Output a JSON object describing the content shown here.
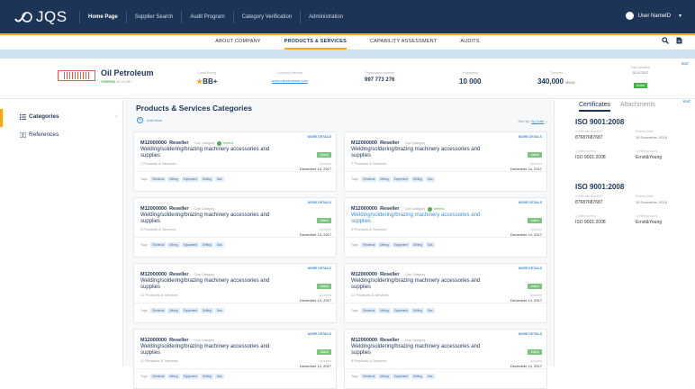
{
  "app": {
    "logo": "JQS"
  },
  "nav": {
    "items": [
      "Home Page",
      "Supplier Search",
      "Audit Program",
      "Category Verification",
      "Administration"
    ],
    "active": 0
  },
  "user": {
    "name": "User NameID"
  },
  "subnav": {
    "items": [
      "ABOUT COMPANY",
      "PRODUCTS & SERVICES",
      "CAPABILITY ASSESSMENT",
      "AUDITS"
    ],
    "active": 1
  },
  "company": {
    "logo_text": "OIL PETROLEUM",
    "name": "Oil Petroleum",
    "status_label": "VERIFIED",
    "status_date": "12.10.2017",
    "credit_rating_label": "Credit Rating",
    "credit_rating": "BB+",
    "website_label": "Company Website",
    "website": "www.oilpetroleum.com",
    "org_number_label": "Organisation number",
    "org_number": "997 773 276",
    "employees_label": "Employees",
    "employees": "10 000",
    "turnover_label": "Turnover",
    "turnover": "340,000",
    "turnover_unit": "MNOK",
    "last_updated_label": "Last Updated",
    "last_updated": "02.12.2017",
    "last_updated_badge": "Active",
    "edit": "EDIT"
  },
  "sidebar": {
    "items": [
      "Categories",
      "References"
    ],
    "active": 0
  },
  "main": {
    "title": "Products & Services Categories",
    "add_more": "Add More",
    "sort_by_label": "Sort by:",
    "sort_by_value": "By Date",
    "cards": [
      {
        "code": "M12000000",
        "type": "Reseller",
        "cat": "Core Category",
        "verified": true,
        "title": "Welding/soldering/brazing machinery accessories and supplies",
        "title_blue": false,
        "count": "7 Products & Services",
        "status": "Active",
        "updated": "Updated",
        "date": "December 14, 2017"
      },
      {
        "code": "M12000000",
        "type": "Reseller",
        "cat": "Core Category",
        "verified": false,
        "title": "Welding/soldering/brazing machinery accessories and supplies",
        "title_blue": false,
        "count": "7 Products & Services",
        "status": "Active",
        "updated": "Updated",
        "date": "December 14, 2017"
      },
      {
        "code": "M12000000",
        "type": "Reseller",
        "cat": "Core Category",
        "verified": false,
        "title": "Welding/soldering/brazing machinery accessories and supplies",
        "title_blue": false,
        "count": "3 Products & Services",
        "status": "Active",
        "updated": "Updated",
        "date": "December 14, 2017"
      },
      {
        "code": "M12000000",
        "type": "Reseller",
        "cat": "Core Category",
        "verified": true,
        "title": "Welding/soldering/brazing machinery accessories and supplies",
        "title_blue": true,
        "count": "3 Products & Services",
        "status": "Active",
        "updated": "Updated",
        "date": "December 14, 2017"
      },
      {
        "code": "M12000000",
        "type": "Reseller",
        "cat": "Core Category",
        "verified": false,
        "title": "Welding/soldering/brazing machinery accessories and supplies",
        "title_blue": false,
        "count": "12 Products & Services",
        "status": "Active",
        "updated": "Updated",
        "date": "December 14, 2017"
      },
      {
        "code": "M12000000",
        "type": "Reseller",
        "cat": "Core Category",
        "verified": false,
        "title": "Welding/soldering/brazing machinery accessories and supplies",
        "title_blue": false,
        "count": "12 Products & Services",
        "status": "Active",
        "updated": "Updated",
        "date": "December 14, 2017"
      },
      {
        "code": "M12000000",
        "type": "Reseller",
        "cat": "Core Category",
        "verified": false,
        "title": "Welding/soldering/brazing machinery accessories and supplies",
        "title_blue": false,
        "count": "12 Products & Services",
        "status": "Active",
        "updated": "Updated",
        "date": "December 14, 2017"
      },
      {
        "code": "M12000000",
        "type": "Reseller",
        "cat": "Core Category",
        "verified": false,
        "title": "Welding/soldering/brazing machinery accessories and supplies",
        "title_blue": false,
        "count": "8 Products & Services",
        "status": "Active",
        "updated": "Updated",
        "date": "December 14, 2017"
      }
    ],
    "more_details": "MORE DETAILS",
    "verified_label": "Verified",
    "tags_label": "Tags:",
    "tags": [
      "Electrical",
      "Mining",
      "Equipment",
      "Drilling",
      "Gas"
    ]
  },
  "right": {
    "tabs": [
      "Certificates",
      "Attachments"
    ],
    "active": 0,
    "edit": "EDIT",
    "certs": [
      {
        "title": "ISO 9001:2008",
        "f1_label": "Certificate Number",
        "f1": "87687687687",
        "f2_label": "Expired Date",
        "f2": "15 December, 2018",
        "f3_label": "Quality system",
        "f3": "ISO 9001:2008",
        "f4_label": "Certifying agent",
        "f4": "Ernst&Young"
      },
      {
        "title": "ISO 9001:2008",
        "f1_label": "Certificate Number",
        "f1": "87687687687",
        "f2_label": "Expired Date",
        "f2": "15 December, 2018",
        "f3_label": "Quality system",
        "f3": "ISO 9001:2008",
        "f4_label": "Certifying agent",
        "f4": "Ernst&Young"
      }
    ]
  },
  "colors": {
    "nav_bg": "#1c3557",
    "accent": "#f5a623",
    "link": "#3b8fd6",
    "active_green": "#4caf50",
    "band": "#cfe0ef"
  }
}
